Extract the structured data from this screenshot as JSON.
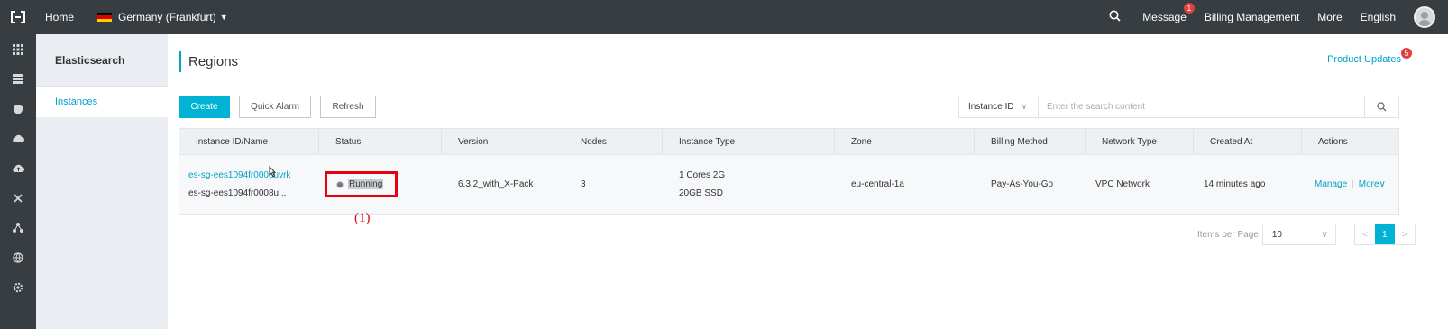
{
  "topbar": {
    "home": "Home",
    "region": "Germany (Frankfurt)",
    "message": "Message",
    "message_count": "1",
    "billing": "Billing Management",
    "more": "More",
    "language": "English"
  },
  "sidebar": {
    "title": "Elasticsearch",
    "items": [
      {
        "label": "Instances"
      }
    ]
  },
  "page": {
    "title": "Regions",
    "updates": "Product Updates",
    "updates_count": "5"
  },
  "toolbar": {
    "create": "Create",
    "quick_alarm": "Quick Alarm",
    "refresh": "Refresh"
  },
  "search": {
    "field": "Instance ID",
    "placeholder": "Enter the search content"
  },
  "table": {
    "headers": [
      "Instance ID/Name",
      "Status",
      "Version",
      "Nodes",
      "Instance Type",
      "Zone",
      "Billing Method",
      "Network Type",
      "Created At",
      "Actions"
    ],
    "rows": [
      {
        "id": "es-sg-ees1094fr0008uvrk",
        "name": "es-sg-ees1094fr0008u...",
        "status": "Running",
        "version": "6.3.2_with_X-Pack",
        "nodes": "3",
        "type_line1": "1 Cores 2G",
        "type_line2": "20GB SSD",
        "zone": "eu-central-1a",
        "billing": "Pay-As-You-Go",
        "network": "VPC Network",
        "created": "14 minutes ago",
        "manage": "Manage",
        "more": "More"
      }
    ]
  },
  "callout": "(1)",
  "pagination": {
    "label": "Items per Page",
    "size": "10",
    "current": "1"
  },
  "colors": {
    "accent": "#00a2ca",
    "topbar": "#373d41",
    "highlight": "#e60012"
  }
}
